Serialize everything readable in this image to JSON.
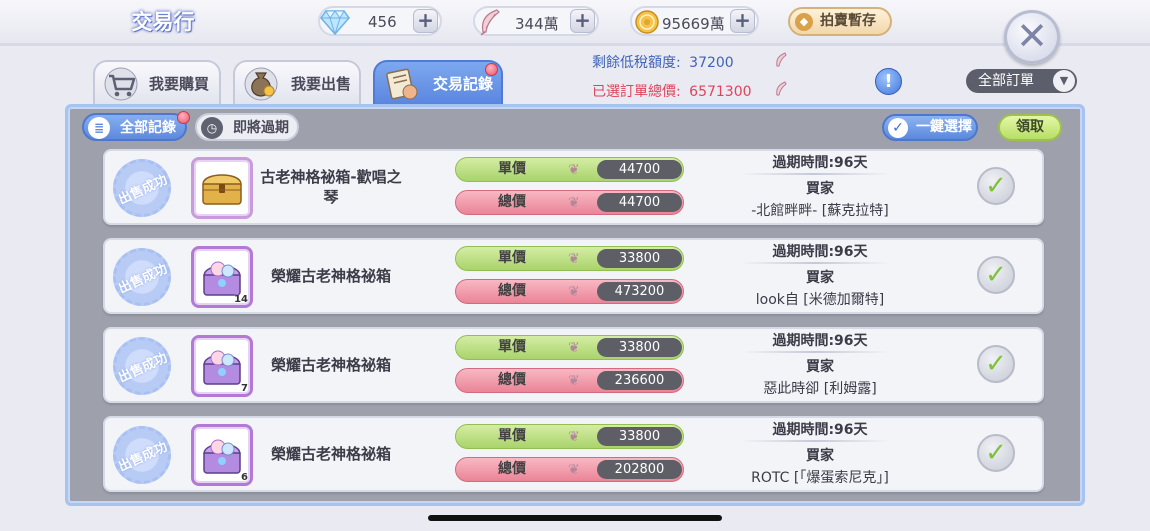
{
  "header": {
    "title": "交易行",
    "diamond": {
      "icon": "diamond-icon",
      "value": "456"
    },
    "feather": {
      "icon": "feather-icon",
      "value": "344萬"
    },
    "zeny": {
      "icon": "coin-icon",
      "value": "95669萬"
    },
    "plus": "+",
    "auction_label": "拍賣暫存",
    "close_icon": "✕"
  },
  "tabs": [
    {
      "label": "我要購買",
      "icon": "cart-icon",
      "active": false
    },
    {
      "label": "我要出售",
      "icon": "money-bag-icon",
      "active": false
    },
    {
      "label": "交易記錄",
      "icon": "record-icon",
      "active": true
    }
  ],
  "info": {
    "tax_label": "剩餘低稅額度:",
    "tax_value": "37200",
    "selected_label": "已選訂單總價:",
    "selected_value": "6571300"
  },
  "dropdown": {
    "selected": "全部訂單"
  },
  "filters": {
    "all": "全部記錄",
    "expiring": "即將過期"
  },
  "actions": {
    "one_click": "一鍵選擇",
    "claim": "領取"
  },
  "labels": {
    "unit": "單價",
    "total": "總價",
    "buyer": "買家",
    "stamp": "出售成功"
  },
  "records": [
    {
      "name": "古老神格祕箱-歡唱之琴",
      "count": "",
      "unit_price": "44700",
      "total_price": "44700",
      "expiry": "過期時間:96天",
      "buyer": "-北館畔畔- [蘇克拉特]"
    },
    {
      "name": "榮耀古老神格祕箱",
      "count": "14",
      "unit_price": "33800",
      "total_price": "473200",
      "expiry": "過期時間:96天",
      "buyer": "look自 [米德加爾特]"
    },
    {
      "name": "榮耀古老神格祕箱",
      "count": "7",
      "unit_price": "33800",
      "total_price": "236600",
      "expiry": "過期時間:96天",
      "buyer": "惡此時卻 [利姆露]"
    },
    {
      "name": "榮耀古老神格祕箱",
      "count": "6",
      "unit_price": "33800",
      "total_price": "202800",
      "expiry": "過期時間:96天",
      "buyer": "ROTC [「爆蛋索尼克」]"
    }
  ],
  "colors": {
    "accent_blue": "#5e89dd",
    "unit_green": "#a9d36b",
    "total_red": "#ea8497",
    "claim_green": "#b7de66"
  }
}
